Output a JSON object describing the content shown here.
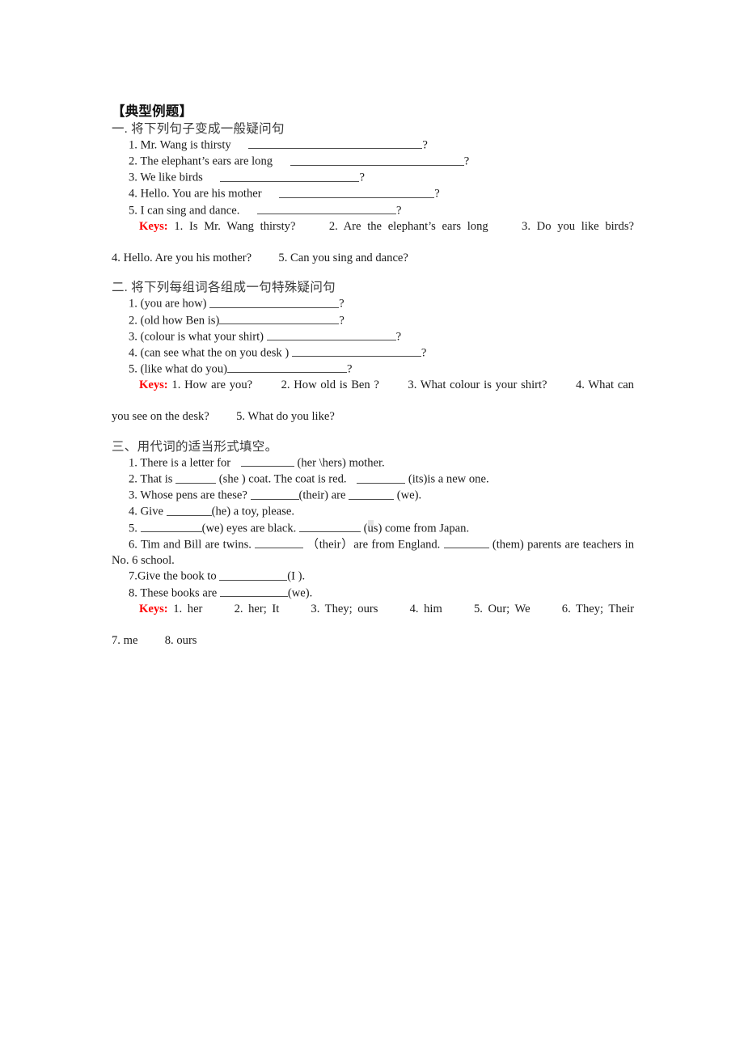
{
  "document": {
    "title": "【典型例题】",
    "sections": [
      {
        "heading": "一. 将下列句子变成一般疑问句",
        "items": [
          {
            "num": "1.",
            "text": "Mr. Wang is thirsty",
            "tail": "?"
          },
          {
            "num": "2.",
            "text": "The elephant’s ears are long",
            "tail": "?"
          },
          {
            "num": "3.",
            "text": "We like birds",
            "tail": "?"
          },
          {
            "num": "4.",
            "text": "Hello. You are his mother",
            "tail": "?"
          },
          {
            "num": "5.",
            "text": "I can sing and dance.",
            "tail": "?"
          }
        ],
        "keys_label": "Keys:",
        "keys_answers": [
          "1. Is Mr. Wang thirsty?",
          "2. Are the elephant’s ears long",
          "3. Do you like birds?",
          "4. Hello. Are you his mother?",
          "5. Can you sing and dance?"
        ]
      },
      {
        "heading": "二. 将下列每组词各组成一句特殊疑问句",
        "items": [
          {
            "num": "1.",
            "text": "(you are how)",
            "tail": "?"
          },
          {
            "num": "2.",
            "text": "(old how Ben is)",
            "tail": "?"
          },
          {
            "num": "3.",
            "text": "(colour is what your shirt)",
            "tail": "?"
          },
          {
            "num": "4.",
            "text": "(can see what the on you desk )",
            "tail": "?"
          },
          {
            "num": "5.",
            "text": "(like what do you)",
            "tail": "?"
          }
        ],
        "keys_label": "Keys:",
        "keys_answers": [
          "1. How are you?",
          "2. How old is Ben ?",
          "3. What colour is your shirt?",
          "4. What can you see on the desk?",
          "5. What do you like?"
        ]
      },
      {
        "heading": "三、用代词的适当形式填空。",
        "items": [
          {
            "num": "1.",
            "a": "There is a letter for",
            "b": "(her \\hers) mother."
          },
          {
            "num": "2.",
            "a": "That is",
            "b": "(she ) coat. The coat is red.",
            "c": "(its)is a new one."
          },
          {
            "num": "3.",
            "a": "Whose pens are these?",
            "b": "(their) are",
            "c": "(we)."
          },
          {
            "num": "4.",
            "a": "Give",
            "b": "(he) a toy, please."
          },
          {
            "num": "5.",
            "a": "",
            "b": "(we) eyes are black.",
            "c": "(us) come from Japan."
          },
          {
            "num": "6.",
            "a": "Tim and Bill are twins.",
            "b": "（their）are from England.",
            "c": "(them) parents are teachers in No. 6 school."
          },
          {
            "num": "7.",
            "a": "Give the book to",
            "b": "(I )."
          },
          {
            "num": "8.",
            "a": "These books are",
            "b": "(we)."
          }
        ],
        "keys_label": "Keys:",
        "keys_answers": [
          "1. her",
          "2. her; It",
          "3. They; ours",
          "4. him",
          "5. Our; We",
          "6. They; Their",
          "7. me",
          "8. ours"
        ]
      }
    ]
  },
  "colors": {
    "keys_red": "#ff0000",
    "body_text": "#1a1a1a",
    "heading_gray": "#3a3a3a",
    "rule": "#4a4a4a",
    "page_bg": "#ffffff"
  }
}
